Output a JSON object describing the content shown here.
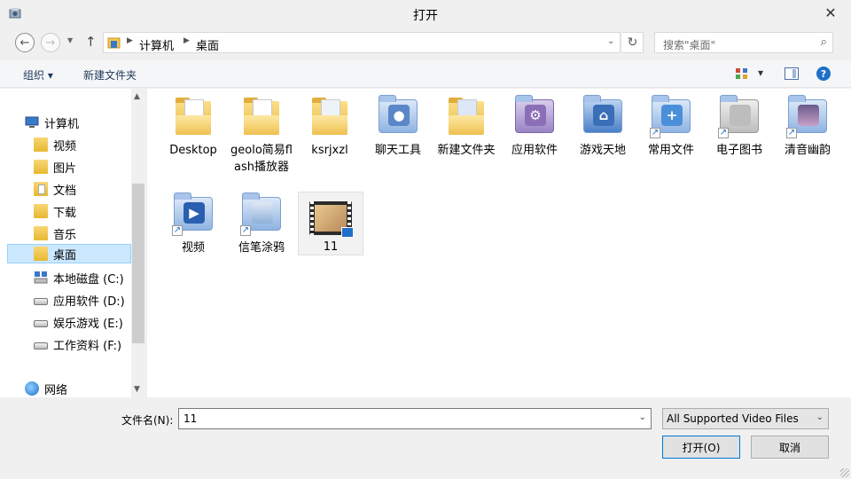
{
  "window": {
    "title": "打开",
    "close_glyph": "✕"
  },
  "nav": {
    "back_glyph": "←",
    "forward_glyph": "→",
    "recent_glyph": "▼",
    "up_glyph": "↑",
    "breadcrumb": [
      "计算机",
      "桌面"
    ],
    "refresh_glyph": "↻",
    "search_placeholder": "搜索\"桌面\"",
    "search_glyph": "⌕"
  },
  "toolbar": {
    "organize_label": "组织 ▾",
    "new_folder_label": "新建文件夹",
    "view_dropdown_glyph": "▾",
    "help_glyph": "?"
  },
  "sidebar": {
    "items": [
      {
        "label": "计算机",
        "icon": "computer-icon"
      },
      {
        "label": "视频",
        "icon": "folder-icon"
      },
      {
        "label": "图片",
        "icon": "folder-icon"
      },
      {
        "label": "文档",
        "icon": "folder-icon"
      },
      {
        "label": "下载",
        "icon": "folder-icon"
      },
      {
        "label": "音乐",
        "icon": "folder-icon"
      },
      {
        "label": "桌面",
        "icon": "folder-icon",
        "selected": true
      },
      {
        "label": "本地磁盘 (C:)",
        "icon": "drive-icon"
      },
      {
        "label": "应用软件 (D:)",
        "icon": "drive-icon"
      },
      {
        "label": "娱乐游戏 (E:)",
        "icon": "drive-icon"
      },
      {
        "label": "工作资料 (F:)",
        "icon": "drive-icon"
      },
      {
        "label": "网络",
        "icon": "network-icon"
      }
    ]
  },
  "files": [
    {
      "name": "Desktop",
      "type": "folder"
    },
    {
      "name": "geolo简易flash播放器",
      "type": "folder"
    },
    {
      "name": "ksrjxzl",
      "type": "folder"
    },
    {
      "name": "聊天工具",
      "type": "system-folder",
      "color": "#5b86c7"
    },
    {
      "name": "新建文件夹",
      "type": "folder"
    },
    {
      "name": "应用软件",
      "type": "system-folder",
      "color": "#8a6fb8"
    },
    {
      "name": "游戏天地",
      "type": "system-folder",
      "color": "#3a6fb8"
    },
    {
      "name": "常用文件",
      "type": "shortcut-folder",
      "color": "#4a8fd8"
    },
    {
      "name": "电子图书",
      "type": "shortcut-folder",
      "color": "#bdbdbd"
    },
    {
      "name": "清音幽韵",
      "type": "shortcut-folder",
      "color": "#6a5a8a"
    },
    {
      "name": "视频",
      "type": "shortcut-folder",
      "color": "#2a5fb0"
    },
    {
      "name": "信笔涂鸦",
      "type": "shortcut-folder",
      "color": "#8fb0d8"
    },
    {
      "name": "11",
      "type": "video",
      "selected": true
    }
  ],
  "footer": {
    "filename_label": "文件名(N):",
    "filename_value": "11",
    "filter_value": "All Supported Video Files",
    "dropdown_glyph": "⌄",
    "open_label": "打开(O)",
    "cancel_label": "取消"
  }
}
